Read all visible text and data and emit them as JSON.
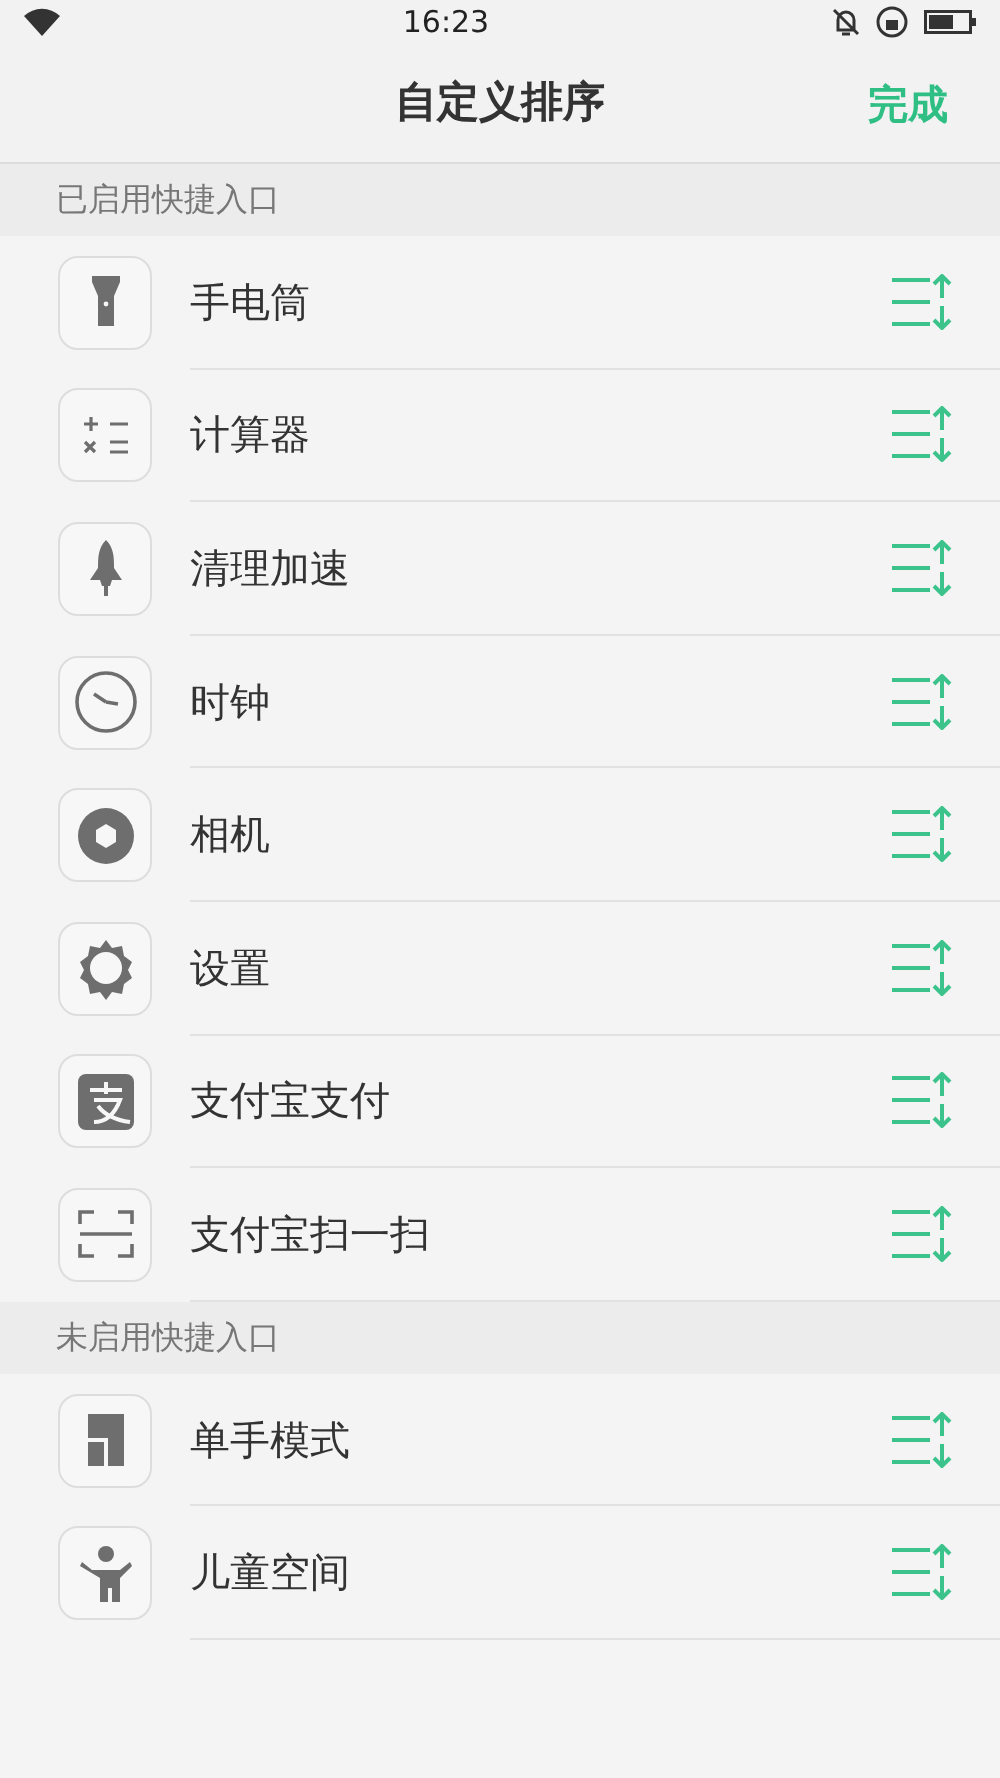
{
  "status_bar": {
    "time": "16:23"
  },
  "header": {
    "title": "自定义排序",
    "done": "完成"
  },
  "sections": [
    {
      "title": "已启用快捷入口",
      "items": [
        {
          "label": "手电筒",
          "kind": "flashlight"
        },
        {
          "label": "计算器",
          "kind": "calculator"
        },
        {
          "label": "清理加速",
          "kind": "rocket"
        },
        {
          "label": "时钟",
          "kind": "clock"
        },
        {
          "label": "相机",
          "kind": "camera"
        },
        {
          "label": "设置",
          "kind": "settings"
        },
        {
          "label": "支付宝支付",
          "kind": "pay"
        },
        {
          "label": "支付宝扫一扫",
          "kind": "scan"
        }
      ]
    },
    {
      "title": "未启用快捷入口",
      "items": [
        {
          "label": "单手模式",
          "kind": "onehand"
        },
        {
          "label": "儿童空间",
          "kind": "kids"
        }
      ]
    }
  ]
}
